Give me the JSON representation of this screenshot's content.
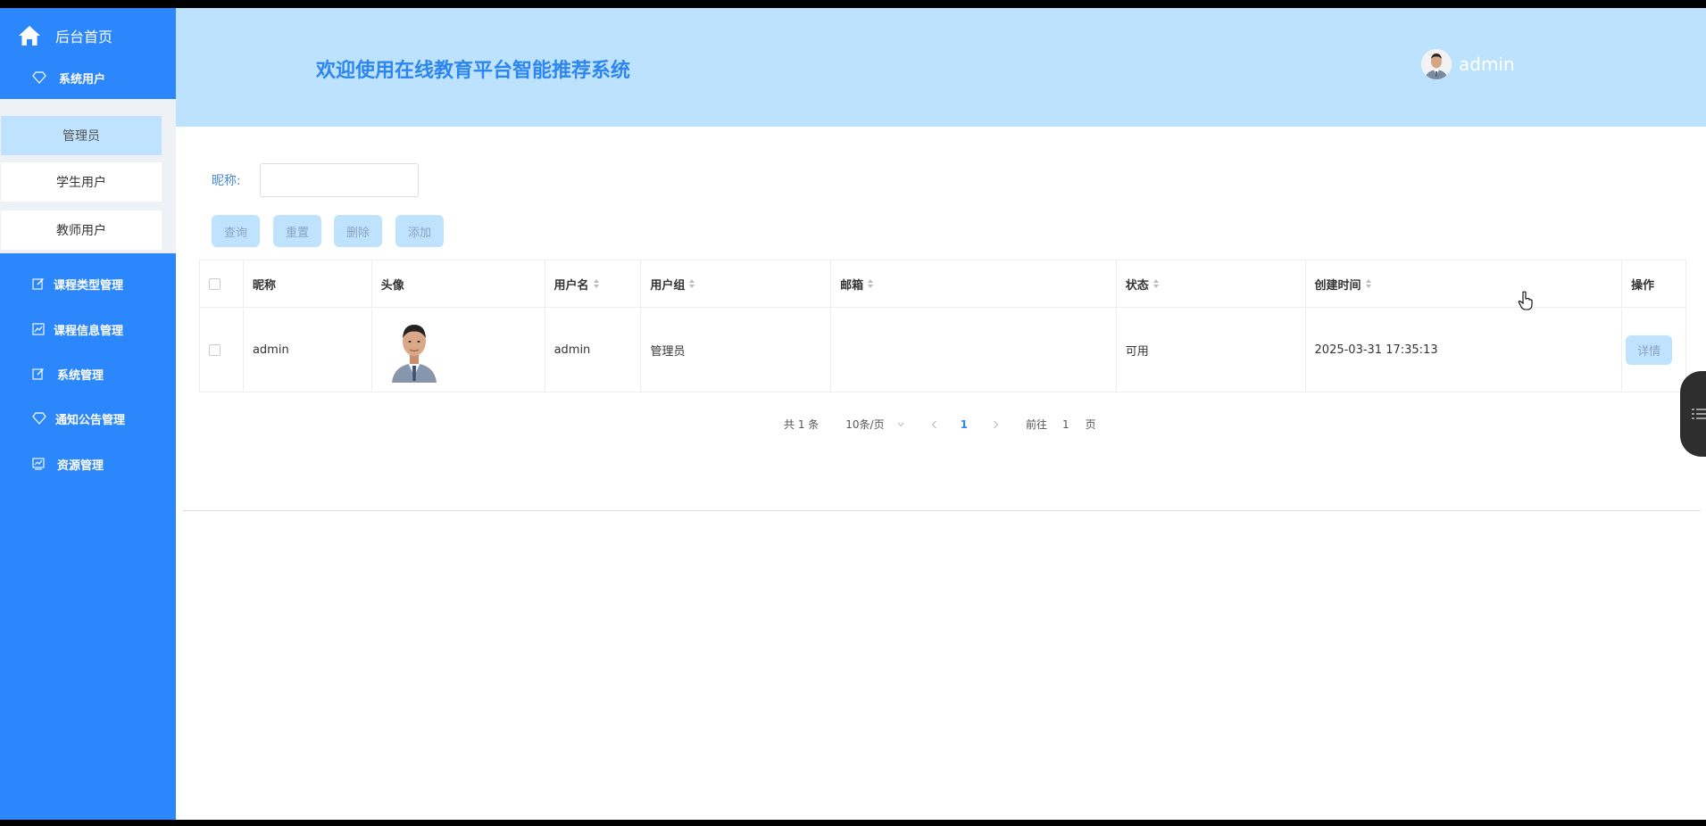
{
  "sidebar": {
    "home": "后台首页",
    "system_users": "系统用户",
    "sub_items": [
      "管理员",
      "学生用户",
      "教师用户"
    ],
    "menus": [
      "课程类型管理",
      "课程信息管理",
      "系统管理",
      "通知公告管理",
      "资源管理"
    ],
    "accent": "#2b87fb"
  },
  "header": {
    "title": "欢迎使用在线教育平台智能推荐系统",
    "user": "admin",
    "bg": "#bde2fd"
  },
  "search": {
    "label": "昵称:",
    "value": "",
    "placeholder": ""
  },
  "buttons": {
    "query": "查询",
    "reset": "重置",
    "delete": "删除",
    "add": "添加"
  },
  "table": {
    "columns": [
      "昵称",
      "头像",
      "用户名",
      "用户组",
      "邮箱",
      "状态",
      "创建时间",
      "操作"
    ],
    "rows": [
      {
        "nickname": "admin",
        "username": "admin",
        "group": "管理员",
        "email": "",
        "status": "可用",
        "created": "2025-03-31 17:35:13",
        "action": "详情"
      }
    ]
  },
  "pagination": {
    "total": "共 1 条",
    "page_size": "10条/页",
    "current": "1",
    "goto_label": "前往",
    "goto_value": "1",
    "page_suffix": "页"
  }
}
